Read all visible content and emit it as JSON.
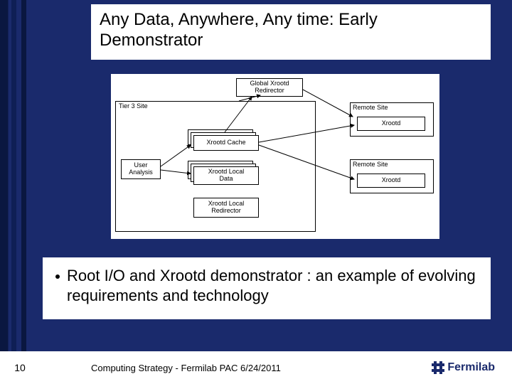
{
  "title": "Any Data, Anywhere, Any time: Early Demonstrator",
  "bullet": "Root I/O and Xrootd demonstrator : an example of evolving requirements and technology",
  "page_number": "10",
  "footer": "Computing Strategy  - Fermilab PAC 6/24/2011",
  "logo_text": "Fermilab",
  "diagram": {
    "tier3_label": "Tier 3 Site",
    "global_redirector": "Global Xrootd\nRedirector",
    "user_analysis": "User\nAnalysis",
    "xrootd_cache": "Xrootd Cache",
    "xrootd_local_data": "Xrootd Local\nData",
    "xrootd_local_redirector": "Xrootd Local\nRedirector",
    "remote_site_1": "Remote Site",
    "remote_site_2": "Remote Site",
    "xrootd_1": "Xrootd",
    "xrootd_2": "Xrootd"
  }
}
